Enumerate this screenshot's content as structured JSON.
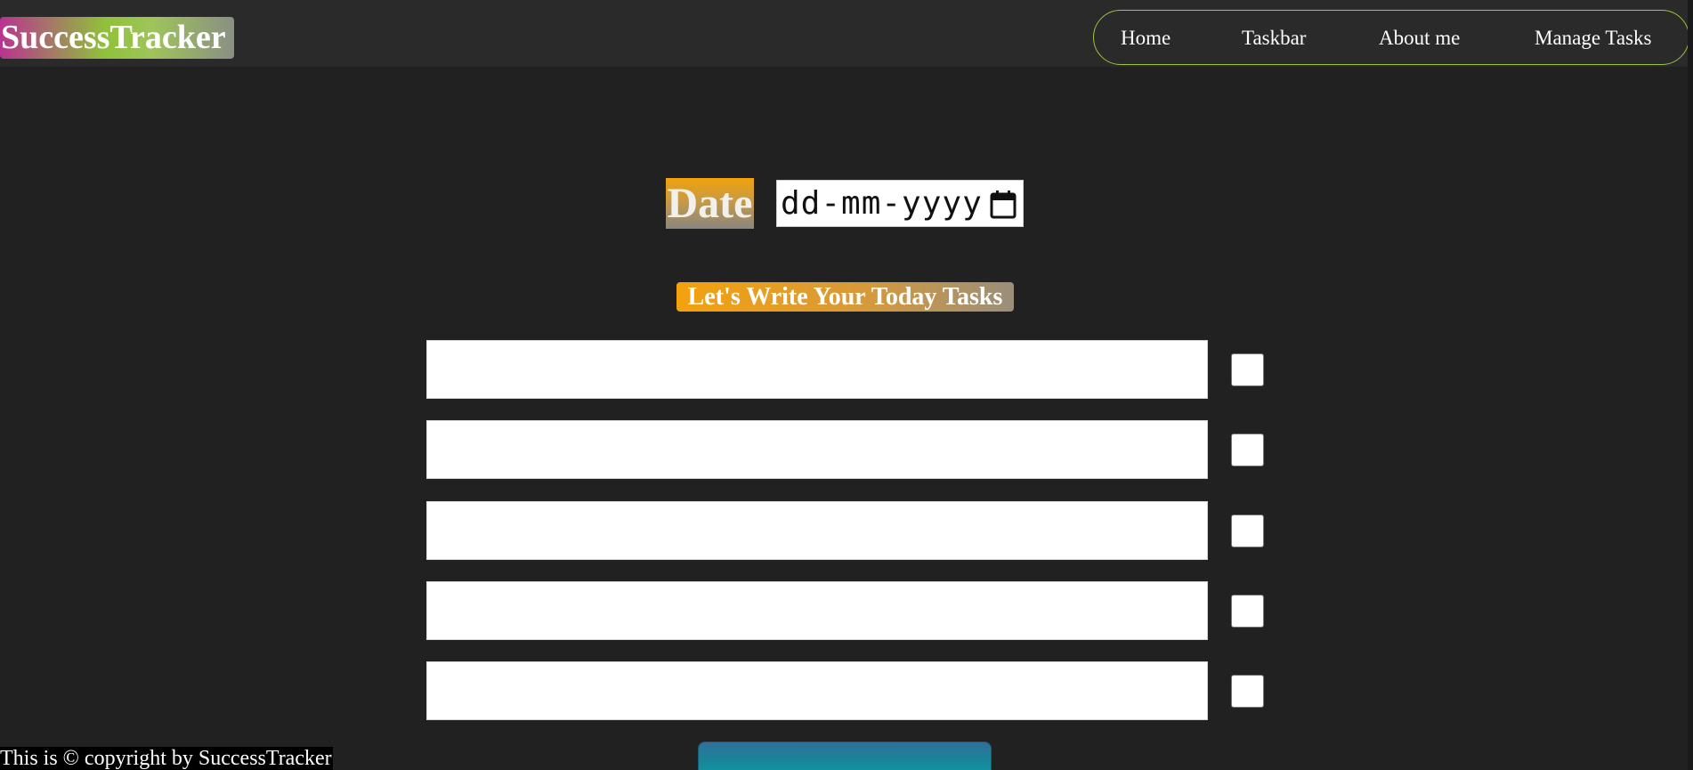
{
  "header": {
    "logo": "SuccessTracker",
    "nav": [
      {
        "label": "Home"
      },
      {
        "label": "Taskbar"
      },
      {
        "label": "About me"
      },
      {
        "label": "Manage Tasks"
      }
    ]
  },
  "date": {
    "label": "Date",
    "placeholder": "dd-mm-yyyy",
    "icon": "calendar-icon"
  },
  "tasks": {
    "heading": "Let's Write Your Today Tasks",
    "items": [
      {
        "value": "",
        "checked": false
      },
      {
        "value": "",
        "checked": false
      },
      {
        "value": "",
        "checked": false
      },
      {
        "value": "",
        "checked": false
      },
      {
        "value": "",
        "checked": false
      }
    ]
  },
  "footer": {
    "text": "This is © copyright by SuccessTracker"
  },
  "colors": {
    "background": "#212121",
    "header_bg": "#2a2a2a",
    "nav_border": "#9bc53d",
    "accent_orange": "#f0a20c",
    "button_teal": "#0e9aa8"
  }
}
